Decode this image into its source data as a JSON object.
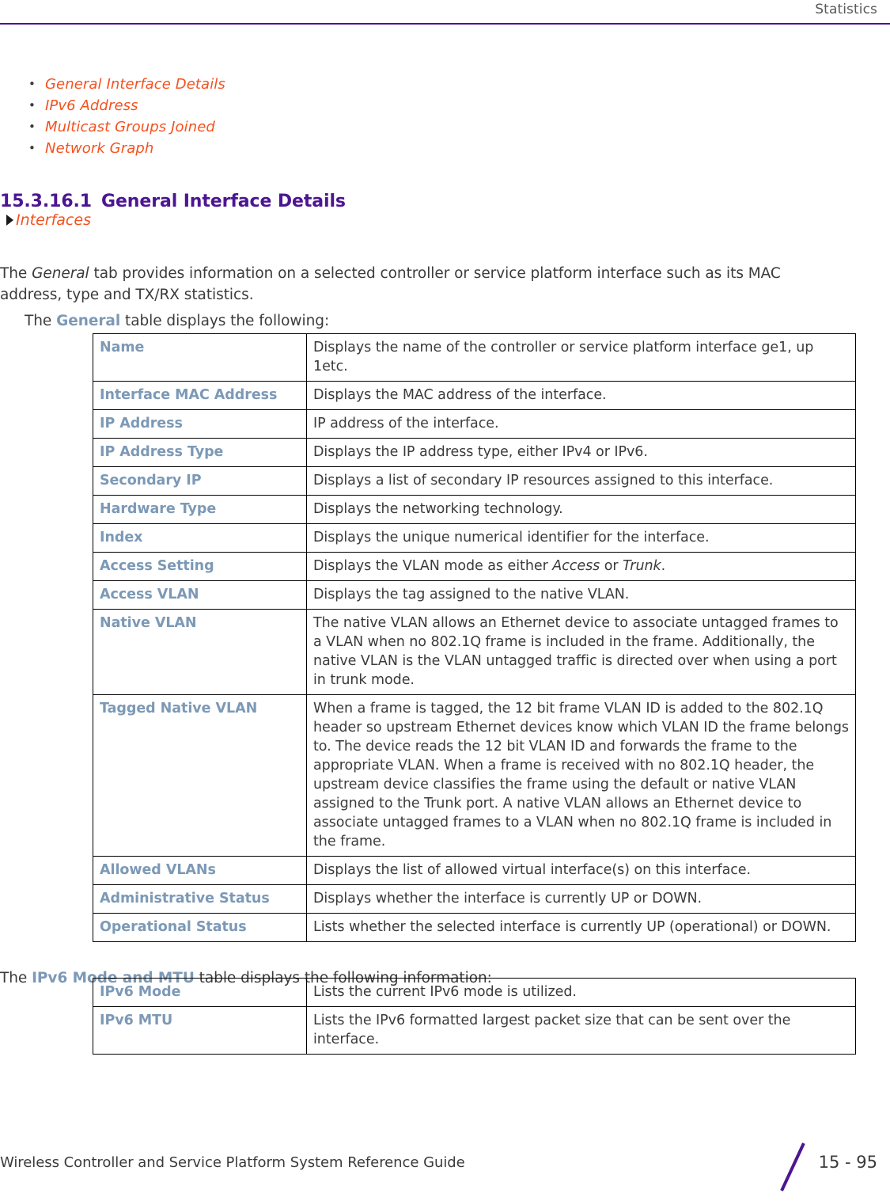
{
  "header": {
    "title": "Statistics",
    "rule_color": "#4C1591"
  },
  "colors": {
    "heading_purple": "#4C1591",
    "link_orange": "#F4511E",
    "label_blue": "#7C99B6",
    "body_gray": "#3B3B3B"
  },
  "xref_list": [
    {
      "label": "General Interface Details"
    },
    {
      "label": "IPv6 Address"
    },
    {
      "label": "Multicast Groups Joined"
    },
    {
      "label": "Network Graph"
    }
  ],
  "section": {
    "number": "15.3.16.1",
    "title": "General Interface Details",
    "breadcrumb": "Interfaces"
  },
  "paragraphs": {
    "intro_part1": "The ",
    "intro_em": "General",
    "intro_part2": " tab provides information on a selected controller or service platform interface such as its MAC address, type and TX/RX statistics.",
    "general_table_lead_1": "The ",
    "general_table_lead_bold": "General",
    "general_table_lead_2": " table displays the following:",
    "ipv6_table_lead_1": "The ",
    "ipv6_table_lead_bold": "IPv6 Mode and MTU",
    "ipv6_table_lead_2": " table displays the following information:"
  },
  "general_table": {
    "rows": [
      {
        "label": "Name",
        "desc": "Displays the name of the controller or service platform interface ge1, up 1etc."
      },
      {
        "label": "Interface MAC Address",
        "desc": "Displays the MAC address of the interface."
      },
      {
        "label": "IP Address",
        "desc": "IP address of the interface."
      },
      {
        "label": "IP Address Type",
        "desc": "Displays the IP address type, either IPv4 or IPv6."
      },
      {
        "label": "Secondary IP",
        "desc": "Displays a list of secondary IP resources assigned to this interface."
      },
      {
        "label": "Hardware Type",
        "desc": "Displays the networking technology."
      },
      {
        "label": "Index",
        "desc": "Displays the unique numerical identifier for the interface."
      },
      {
        "label": "Access Setting",
        "desc_part1": "Displays the VLAN mode as either ",
        "desc_em1": "Access",
        "desc_part2": " or ",
        "desc_em2": "Trunk",
        "desc_part3": "."
      },
      {
        "label": "Access VLAN",
        "desc": "Displays the tag assigned to the native VLAN."
      },
      {
        "label": "Native VLAN",
        "desc": "The native VLAN allows an Ethernet device to associate untagged frames to a VLAN when no 802.1Q frame is included in the frame. Additionally, the native VLAN is the VLAN untagged traffic is directed over when using a port in trunk mode."
      },
      {
        "label": "Tagged Native VLAN",
        "desc": "When a frame is tagged, the 12 bit frame VLAN ID is added to the 802.1Q header so upstream Ethernet devices know which VLAN ID the frame belongs to. The device reads the 12 bit VLAN ID and forwards the frame to the appropriate VLAN. When a frame is received with no 802.1Q header, the upstream device classifies the frame using the default or native VLAN assigned to the Trunk port. A native VLAN allows an Ethernet device to associate untagged frames to a VLAN when no 802.1Q frame is included in the frame."
      },
      {
        "label": "Allowed VLANs",
        "desc": "Displays the list of allowed virtual interface(s) on this interface."
      },
      {
        "label": "Administrative Status",
        "desc": "Displays whether the interface is currently UP or DOWN."
      },
      {
        "label": "Operational Status",
        "desc": "Lists whether the selected interface is currently UP (operational) or DOWN."
      }
    ]
  },
  "ipv6_table": {
    "rows": [
      {
        "label": "IPv6 Mode",
        "desc": "Lists the current IPv6 mode is utilized."
      },
      {
        "label": "IPv6 MTU",
        "desc": "Lists the IPv6 formatted largest packet size that can be sent over the interface."
      }
    ]
  },
  "footer": {
    "guide_title": "Wireless Controller and Service Platform System Reference Guide",
    "page_number": "15 - 95"
  }
}
